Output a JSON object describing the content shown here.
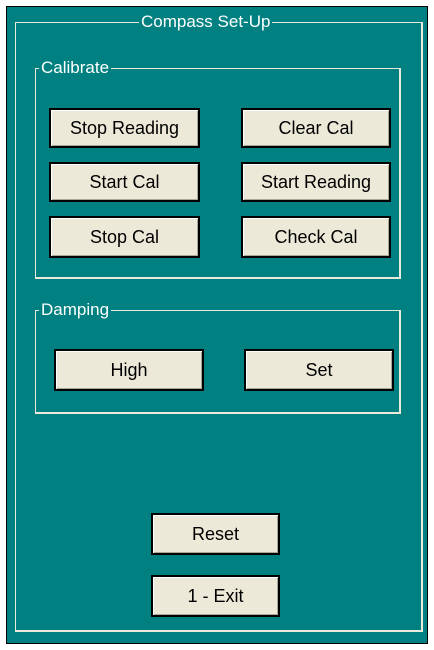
{
  "window": {
    "title": "Compass Set-Up"
  },
  "calibrate": {
    "label": "Calibrate",
    "stop_reading": "Stop Reading",
    "clear_cal": "Clear Cal",
    "start_cal": "Start Cal",
    "start_reading": "Start Reading",
    "stop_cal": "Stop Cal",
    "check_cal": "Check Cal"
  },
  "damping": {
    "label": "Damping",
    "level": "High",
    "set": "Set"
  },
  "footer": {
    "reset": "Reset",
    "exit": "1 - Exit"
  },
  "colors": {
    "background": "#008080",
    "button_face": "#ece9d8",
    "group_border": "#e9eadb",
    "text_light": "#ffffff"
  }
}
